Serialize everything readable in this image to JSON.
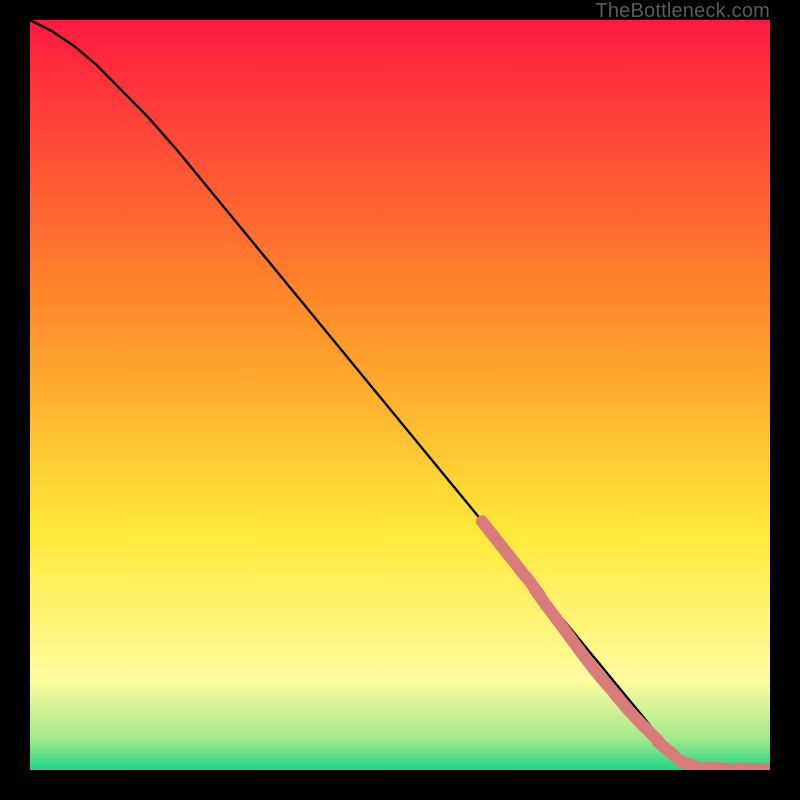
{
  "watermark": "TheBottleneck.com",
  "colors": {
    "red": "#ff1a40",
    "orange": "#ff8a2a",
    "yellow": "#ffe838",
    "paleyellow": "#fffca0",
    "lightgreen": "#9fe98a",
    "green": "#1fd68a",
    "line": "#000000",
    "marker": "#d97b7b",
    "background": "#000000"
  },
  "chart_data": {
    "type": "line",
    "title": "",
    "xlabel": "",
    "ylabel": "",
    "xlim": [
      0,
      100
    ],
    "ylim": [
      0,
      100
    ],
    "x": [
      0,
      3,
      6,
      9,
      12,
      16,
      20,
      25,
      30,
      35,
      40,
      45,
      50,
      55,
      60,
      65,
      70,
      75,
      80,
      85,
      88,
      91,
      93,
      95,
      97,
      100
    ],
    "y": [
      100,
      98.5,
      96.5,
      94,
      91,
      87,
      82.5,
      76.5,
      70.5,
      64.5,
      58.5,
      52.5,
      46.5,
      40.5,
      34.5,
      28.5,
      22.5,
      16.5,
      10.5,
      4.5,
      1.8,
      0.6,
      0.3,
      0.2,
      0.15,
      0.1
    ],
    "markers": {
      "x": [
        62,
        64,
        66,
        68,
        69,
        70.5,
        72,
        73.5,
        75,
        77,
        78.5,
        80,
        82,
        84,
        86,
        89,
        93,
        97,
        100
      ],
      "y": [
        32,
        29.5,
        27,
        24.5,
        23,
        21,
        19,
        17,
        15,
        12.5,
        10.8,
        9,
        6.8,
        4.8,
        2.8,
        0.8,
        0.25,
        0.15,
        0.1
      ]
    }
  }
}
